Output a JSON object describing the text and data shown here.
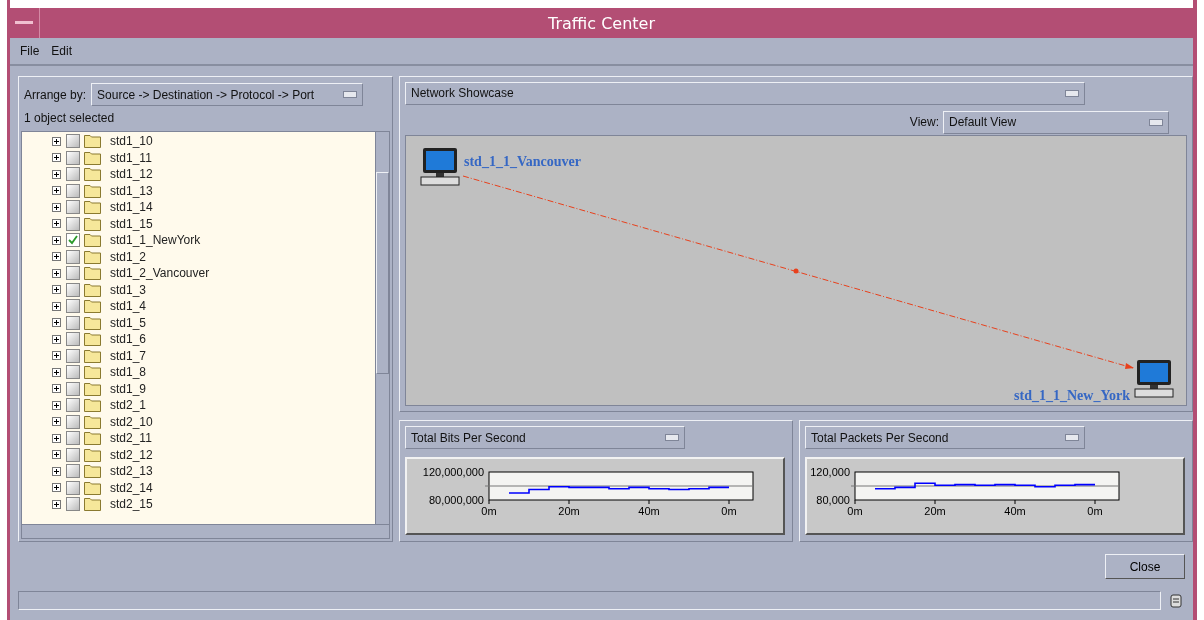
{
  "window": {
    "title": "Traffic Center"
  },
  "menu": [
    {
      "label": "File"
    },
    {
      "label": "Edit"
    }
  ],
  "left_panel": {
    "arrange_by": {
      "label": "Arrange by:",
      "value": "Source -> Destination -> Protocol -> Port"
    },
    "selection_status": "1 object selected",
    "tree": [
      {
        "label": "std1_10",
        "checked": false,
        "expanded": false
      },
      {
        "label": "std1_11",
        "checked": false,
        "expanded": false
      },
      {
        "label": "std1_12",
        "checked": false,
        "expanded": false
      },
      {
        "label": "std1_13",
        "checked": false,
        "expanded": false
      },
      {
        "label": "std1_14",
        "checked": false,
        "expanded": false
      },
      {
        "label": "std1_15",
        "checked": false,
        "expanded": false
      },
      {
        "label": "std1_1_NewYork",
        "checked": true,
        "expanded": false
      },
      {
        "label": "std1_2",
        "checked": false,
        "expanded": false
      },
      {
        "label": "std1_2_Vancouver",
        "checked": false,
        "expanded": false
      },
      {
        "label": "std1_3",
        "checked": false,
        "expanded": false
      },
      {
        "label": "std1_4",
        "checked": false,
        "expanded": false
      },
      {
        "label": "std1_5",
        "checked": false,
        "expanded": false
      },
      {
        "label": "std1_6",
        "checked": false,
        "expanded": false
      },
      {
        "label": "std1_7",
        "checked": false,
        "expanded": false
      },
      {
        "label": "std1_8",
        "checked": false,
        "expanded": false
      },
      {
        "label": "std1_9",
        "checked": false,
        "expanded": false
      },
      {
        "label": "std2_1",
        "checked": false,
        "expanded": false
      },
      {
        "label": "std2_10",
        "checked": false,
        "expanded": false
      },
      {
        "label": "std2_11",
        "checked": false,
        "expanded": false
      },
      {
        "label": "std2_12",
        "checked": false,
        "expanded": false
      },
      {
        "label": "std2_13",
        "checked": false,
        "expanded": false
      },
      {
        "label": "std2_14",
        "checked": false,
        "expanded": false
      },
      {
        "label": "std2_15",
        "checked": false,
        "expanded": false
      }
    ]
  },
  "map_selector": {
    "value": "Network Showcase"
  },
  "view_selector": {
    "label": "View:",
    "value": "Default View"
  },
  "topology": {
    "nodes": [
      {
        "label": "std_1_1_Vancouver"
      },
      {
        "label": "std_1_1_New_York"
      }
    ]
  },
  "charts": [
    {
      "selector": "Total Bits Per Second",
      "chart_data": {
        "type": "line",
        "x": [
          5,
          10,
          10,
          15,
          15,
          20,
          20,
          30,
          30,
          35,
          35,
          40,
          40,
          45,
          45,
          50,
          50,
          55,
          55,
          60
        ],
        "series": [
          {
            "color": "#0000ff",
            "values": [
              90000000,
              90000000,
              95000000,
              95000000,
              99000000,
              99000000,
              98000000,
              98000000,
              96000000,
              96000000,
              98000000,
              98000000,
              96000000,
              96000000,
              95000000,
              95000000,
              96000000,
              96000000,
              98000000,
              98000000
            ]
          }
        ],
        "xlim": [
          0,
          66
        ],
        "ylim": [
          80000000,
          120000000
        ],
        "ref_lines": [
          {
            "axis": "y",
            "value": 100000000
          }
        ],
        "xticks": [
          {
            "value": 0,
            "label": "0m"
          },
          {
            "value": 20,
            "label": "20m"
          },
          {
            "value": 40,
            "label": "40m"
          },
          {
            "value": 60,
            "label": "0m"
          }
        ],
        "yticks": [
          {
            "value": 80000000,
            "label": "80,000,000"
          },
          {
            "value": 120000000,
            "label": "120,000,000"
          }
        ]
      }
    },
    {
      "selector": "Total Packets Per Second",
      "chart_data": {
        "type": "line",
        "x": [
          5,
          10,
          10,
          15,
          15,
          20,
          20,
          25,
          25,
          30,
          30,
          35,
          35,
          40,
          40,
          45,
          45,
          50,
          50,
          55,
          55,
          60
        ],
        "series": [
          {
            "color": "#0000ff",
            "values": [
              96000,
              96000,
              98000,
              98000,
              104000,
              104000,
              101000,
              101000,
              102000,
              102000,
              101000,
              101000,
              102000,
              102000,
              101000,
              101000,
              99000,
              99000,
              101000,
              101000,
              102000,
              102000
            ]
          }
        ],
        "xlim": [
          0,
          66
        ],
        "ylim": [
          80000,
          120000
        ],
        "ref_lines": [
          {
            "axis": "y",
            "value": 100000
          }
        ],
        "xticks": [
          {
            "value": 0,
            "label": "0m"
          },
          {
            "value": 20,
            "label": "20m"
          },
          {
            "value": 40,
            "label": "40m"
          },
          {
            "value": 60,
            "label": "0m"
          }
        ],
        "yticks": [
          {
            "value": 80000,
            "label": "80,000"
          },
          {
            "value": 120000,
            "label": "120,000"
          }
        ]
      }
    }
  ],
  "buttons": [
    {
      "label": "Close"
    }
  ]
}
